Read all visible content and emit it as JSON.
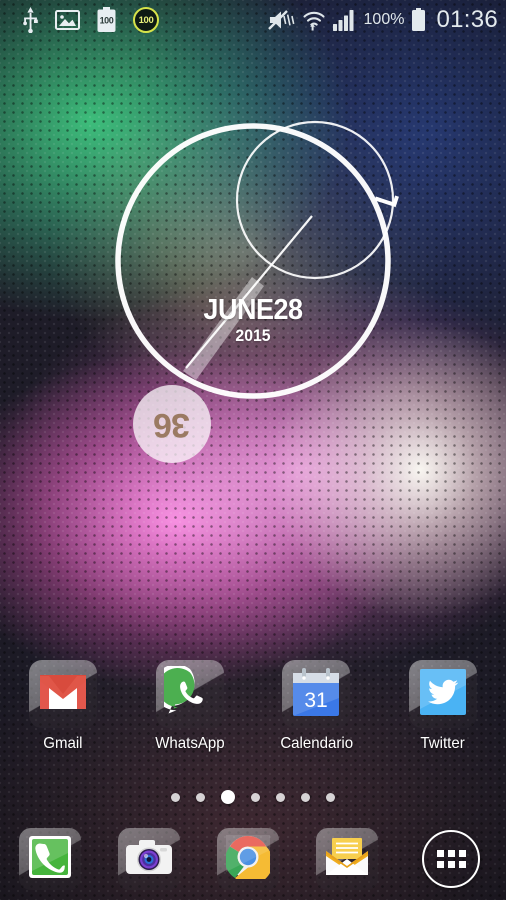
{
  "statusbar": {
    "left_icons": [
      {
        "name": "usb-icon",
        "label": "USB"
      },
      {
        "name": "screenshot-icon",
        "label": "Screenshot"
      },
      {
        "name": "battery-full-icon",
        "label": "100"
      },
      {
        "name": "battery-circle-badge-icon",
        "label": "100"
      }
    ],
    "battery_text": "100",
    "circle_badge_text": "100",
    "right_icons": [
      {
        "name": "sound-mute-vibrate-icon",
        "label": "Mute"
      },
      {
        "name": "wifi-icon",
        "label": "Wi-Fi"
      },
      {
        "name": "cellular-signal-icon",
        "label": "Signal"
      }
    ],
    "battery_percent": "100%",
    "time": "01:36"
  },
  "widget": {
    "name": "clock-date-widget",
    "month_day": "JUNE28",
    "year": "2015",
    "seconds": "36",
    "hour_marker": "1"
  },
  "apps": [
    {
      "label": "Gmail",
      "icon": "gmail-icon"
    },
    {
      "label": "WhatsApp",
      "icon": "whatsapp-icon"
    },
    {
      "label": "Calendario",
      "icon": "calendar-icon"
    },
    {
      "label": "Twitter",
      "icon": "twitter-icon"
    }
  ],
  "pager": {
    "total": 7,
    "active_index": 2
  },
  "dock": {
    "items": [
      {
        "label": "Phone",
        "icon": "phone-icon"
      },
      {
        "label": "Camera",
        "icon": "camera-icon"
      },
      {
        "label": "Chrome",
        "icon": "chrome-icon"
      },
      {
        "label": "Email",
        "icon": "email-icon"
      }
    ],
    "drawer_label": "Apps"
  },
  "colors": {
    "accent_white": "#ffffff",
    "gmail_red": "#e04a3f",
    "whatsapp_green": "#4caf50",
    "calendar_blue": "#3b78e7",
    "twitter_blue": "#4ab3f4",
    "chrome_red": "#e8564a",
    "chrome_green": "#3aa757",
    "chrome_yellow": "#f5bb34",
    "chrome_blue": "#4a90e2",
    "email_yellow": "#f4c028",
    "battery_badge": "#d7e34a"
  }
}
